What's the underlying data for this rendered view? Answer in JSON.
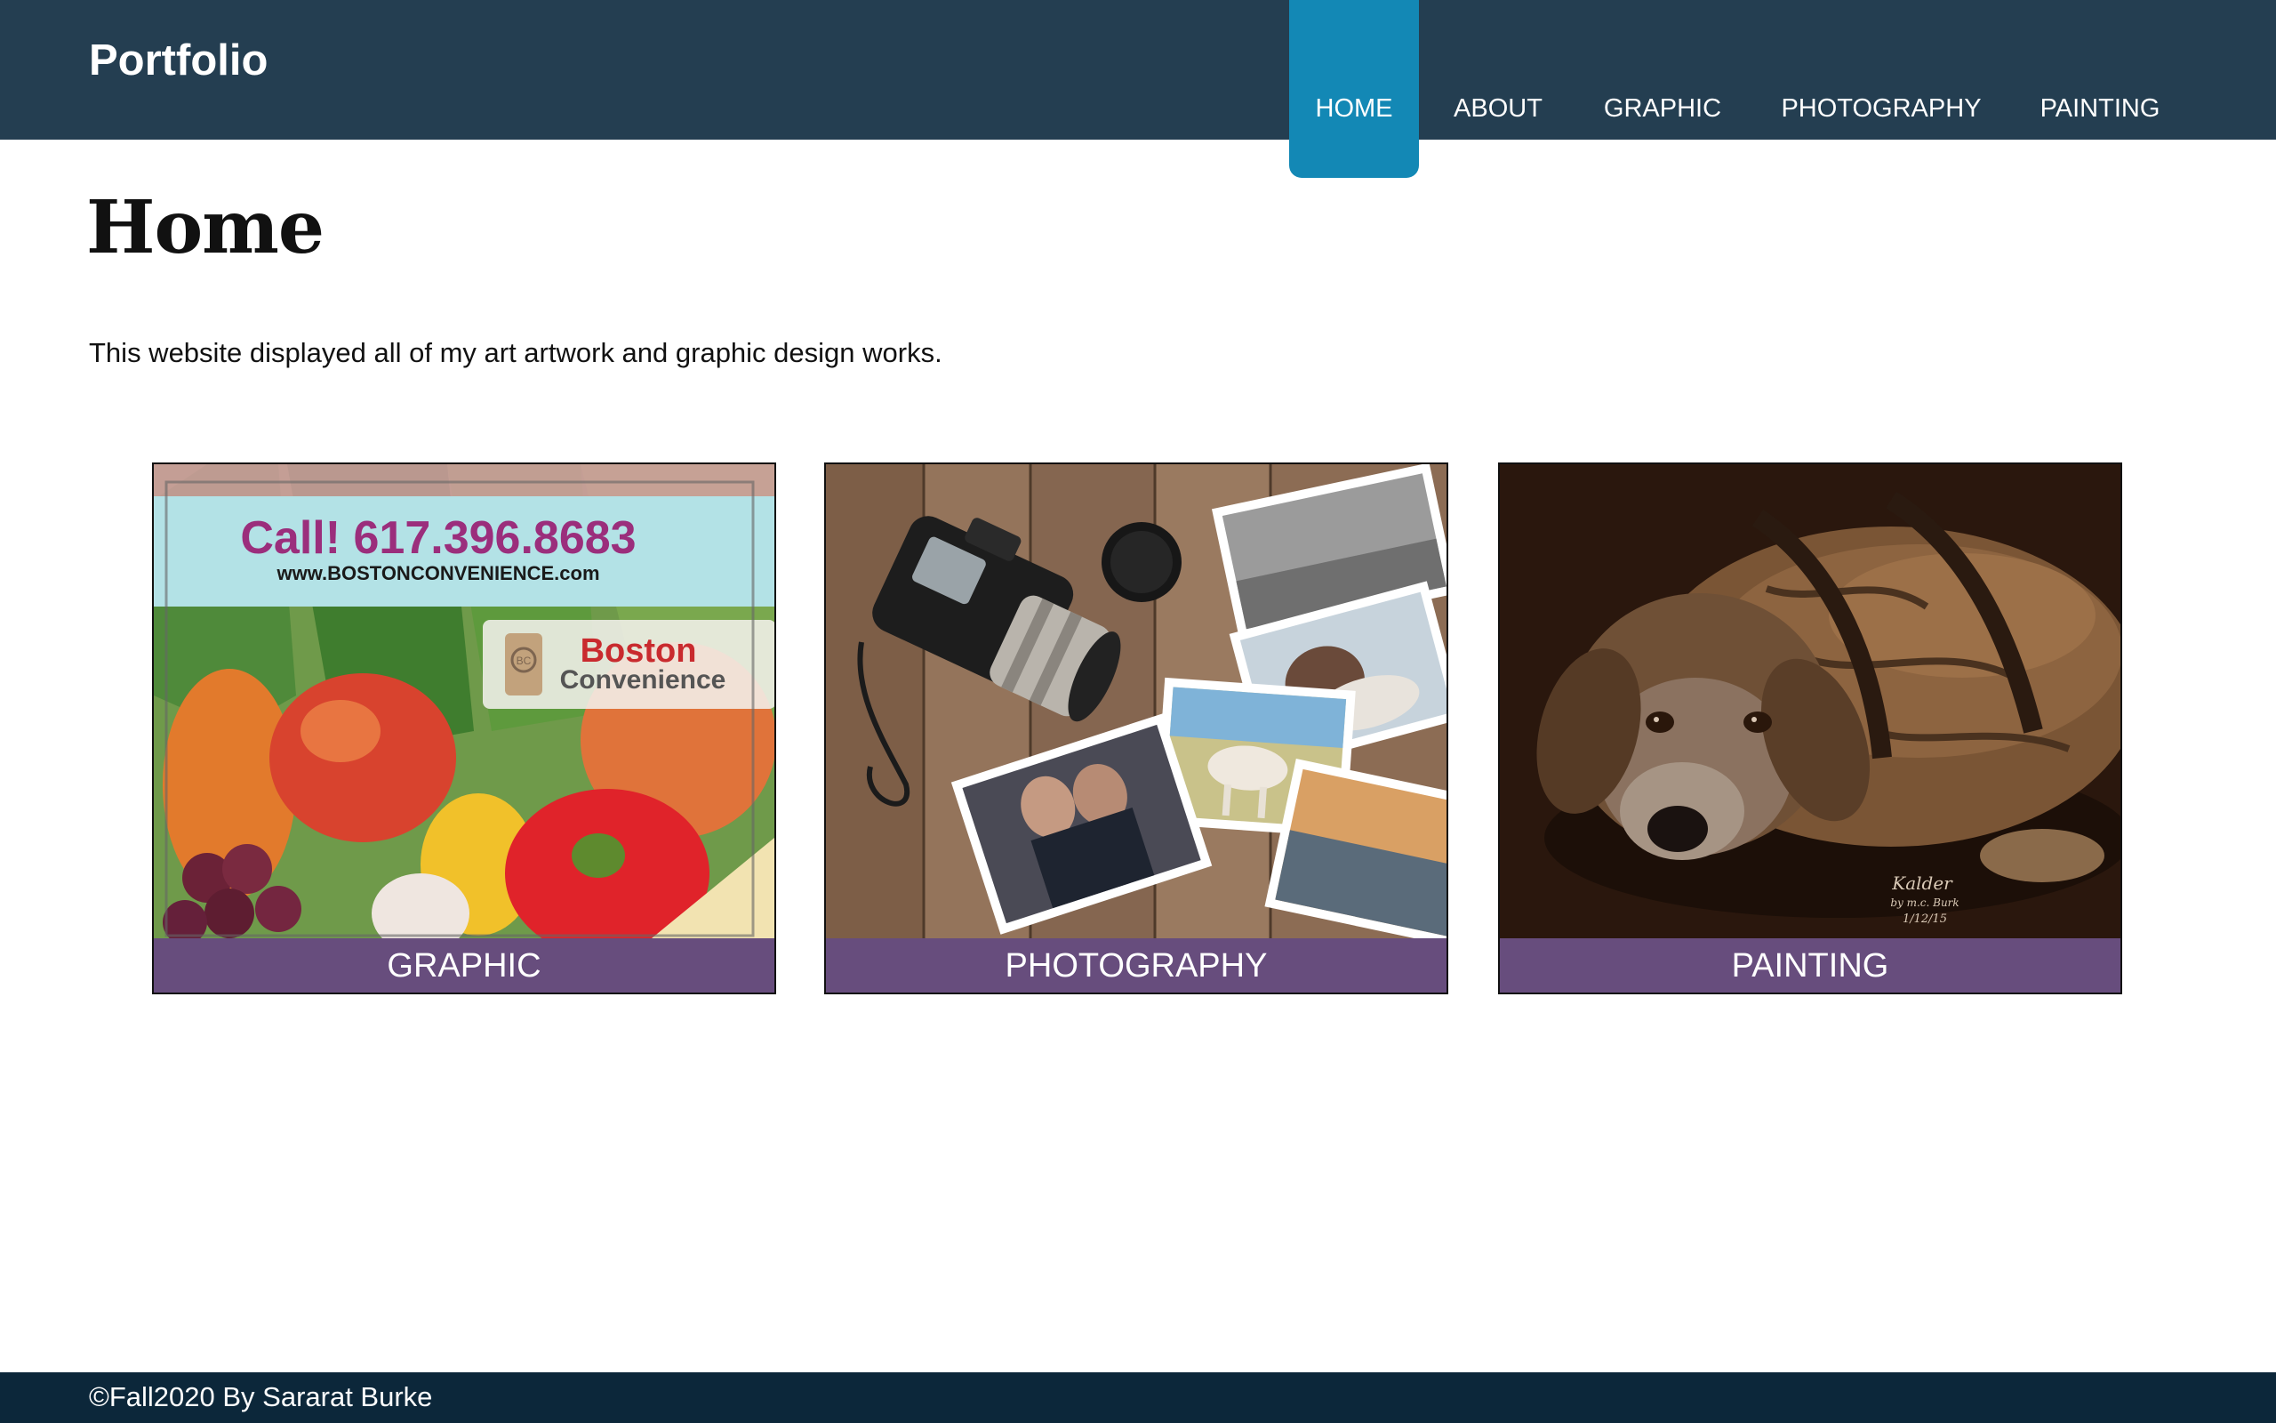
{
  "header": {
    "brand": "Portfolio",
    "nav": [
      {
        "label": "HOME",
        "active": true
      },
      {
        "label": "ABOUT",
        "active": false
      },
      {
        "label": "GRAPHIC",
        "active": false
      },
      {
        "label": "PHOTOGRAPHY",
        "active": false
      },
      {
        "label": "PAINTING",
        "active": false
      }
    ]
  },
  "main": {
    "title": "Home",
    "intro": "This website displayed all of my art artwork and graphic design works.",
    "cards": [
      {
        "label": "GRAPHIC",
        "image": {
          "phone": "Call! 617.396.8683",
          "url": "www.BOSTONCONVENIENCE.com",
          "logo_line1": "Boston",
          "logo_line2": "Convenience",
          "logo_badge": "BC"
        }
      },
      {
        "label": "PHOTOGRAPHY"
      },
      {
        "label": "PAINTING",
        "image": {
          "signature_line1": "Kalder",
          "signature_line2": "by m.c. Burk",
          "signature_line3": "1/12/15"
        }
      }
    ]
  },
  "footer": {
    "copyright": "©Fall2020 By Sararat Burke"
  },
  "colors": {
    "header_bg": "#243e51",
    "nav_active_bg": "#1388b5",
    "card_label_bg": "#674d7d",
    "footer_bg": "#0c273a"
  }
}
